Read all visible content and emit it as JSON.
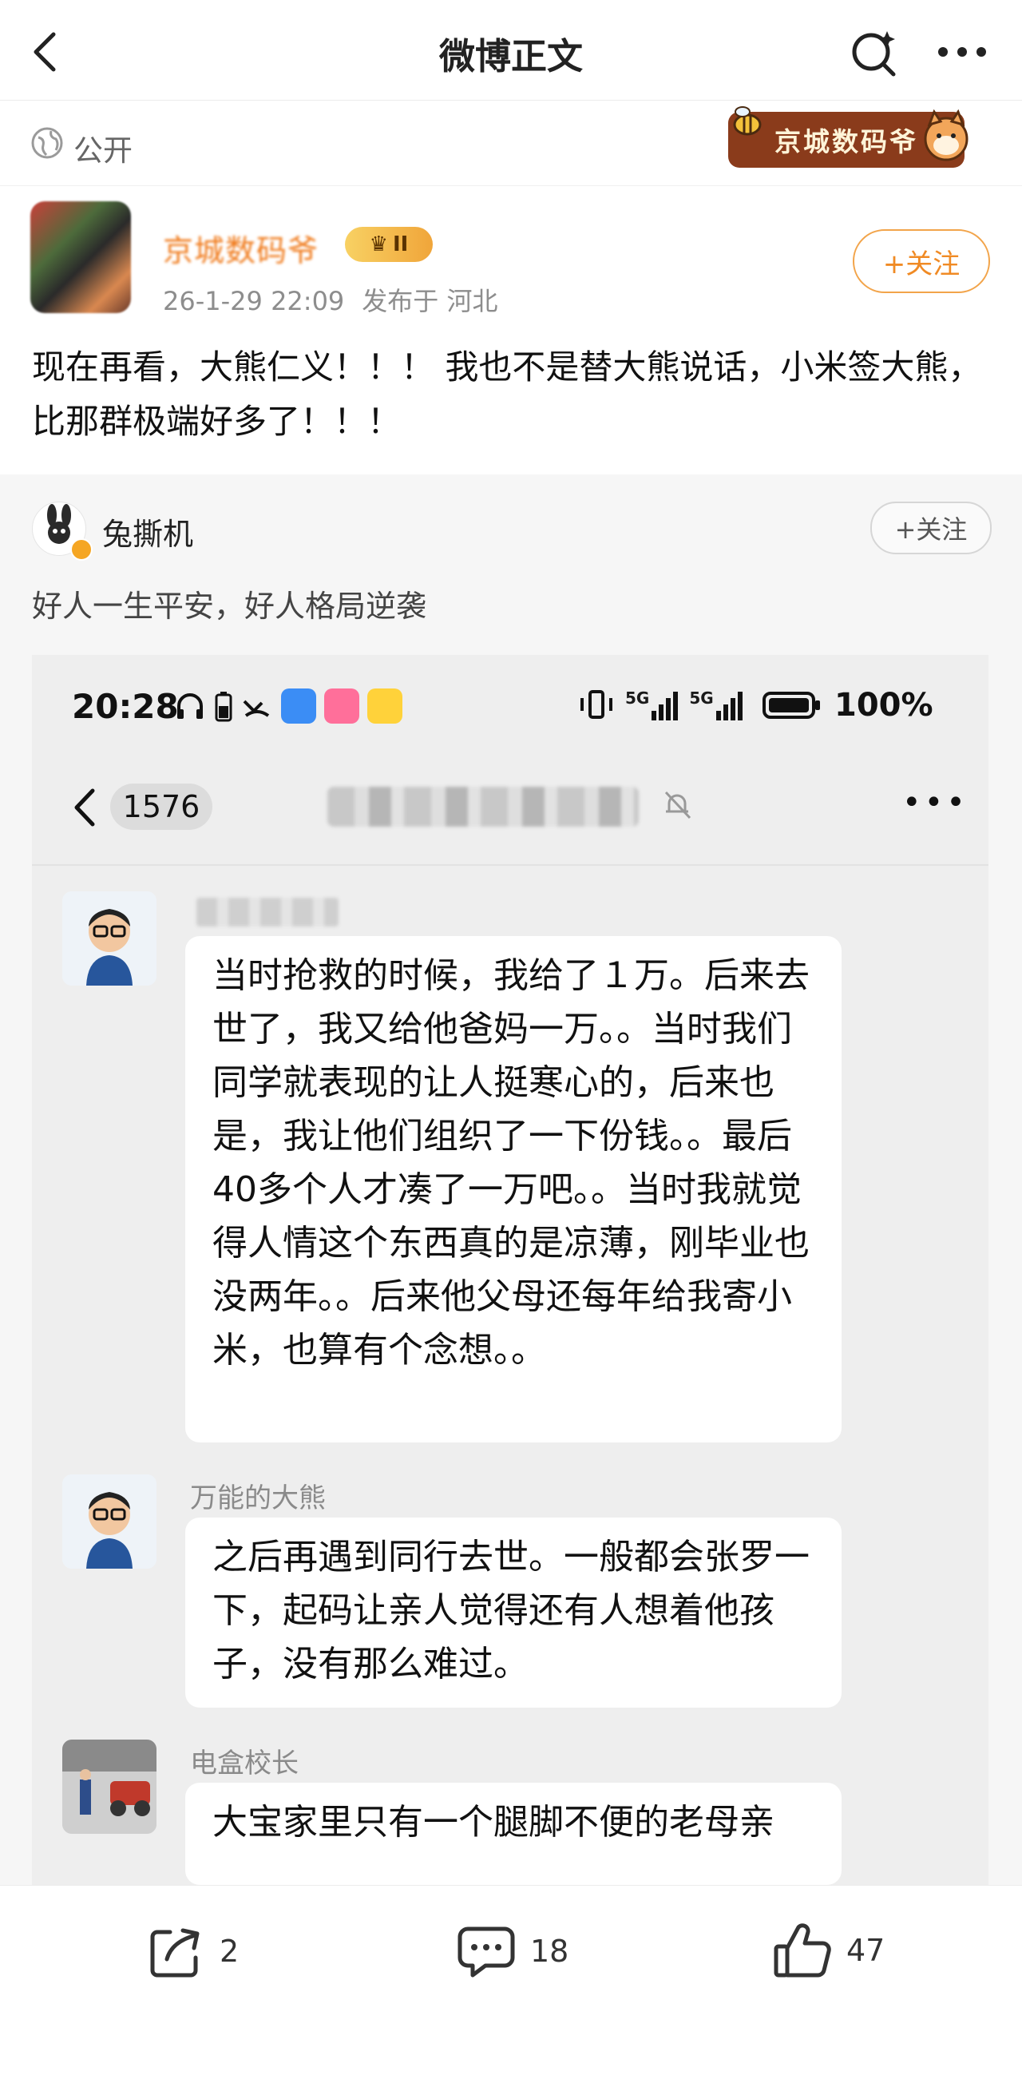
{
  "header": {
    "title": "微博正文",
    "back_icon": "chevron-left-icon",
    "search_icon": "search-spark-icon",
    "more_icon": "more-icon"
  },
  "visibility": {
    "label": "公开",
    "icon": "globe-icon",
    "watermark_badge": "京城数码爷"
  },
  "author": {
    "name": "京城数码爷",
    "level_badge": "II",
    "time": "26-1-29 22:09",
    "location": "发布于 河北",
    "follow_label": "+关注"
  },
  "post": {
    "text": "现在再看，大熊仁义！！！ 我也不是替大熊说话，小米签大熊，比那群极端好多了！！！"
  },
  "repost": {
    "author_name": "兔撕机",
    "follow_label": "+关注",
    "text": "好人一生平安，好人格局逆袭"
  },
  "screenshot": {
    "status_bar": {
      "time": "20:28",
      "signal_1": "5G",
      "signal_2": "5G",
      "battery": "100%"
    },
    "chat": {
      "unread_count": "1576",
      "messages": [
        {
          "sender": "",
          "text": "当时抢救的时候，我给了１万。后来去世了，我又给他爸妈一万。。当时我们同学就表现的让人挺寒心的，后来也是，我让他们组织了一下份钱。。最后40多个人才凑了一万吧。。当时我就觉得人情这个东西真的是凉薄，刚毕业也没两年。。后来他父母还每年给我寄小米，也算有个念想。。"
        },
        {
          "sender": "万能的大熊",
          "text": "之后再遇到同行去世。一般都会张罗一下，起码让亲人觉得还有人想着他孩子，没有那么难过。"
        },
        {
          "sender": "电盒校长",
          "text": "大宝家里只有一个腿脚不便的老母亲"
        }
      ]
    }
  },
  "actions": {
    "repost_count": "2",
    "comment_count": "18",
    "like_count": "47"
  },
  "colors": {
    "accent_orange": "#f08a24",
    "follow_border": "#f2a44a",
    "badge_brown": "#8a3b1b"
  }
}
